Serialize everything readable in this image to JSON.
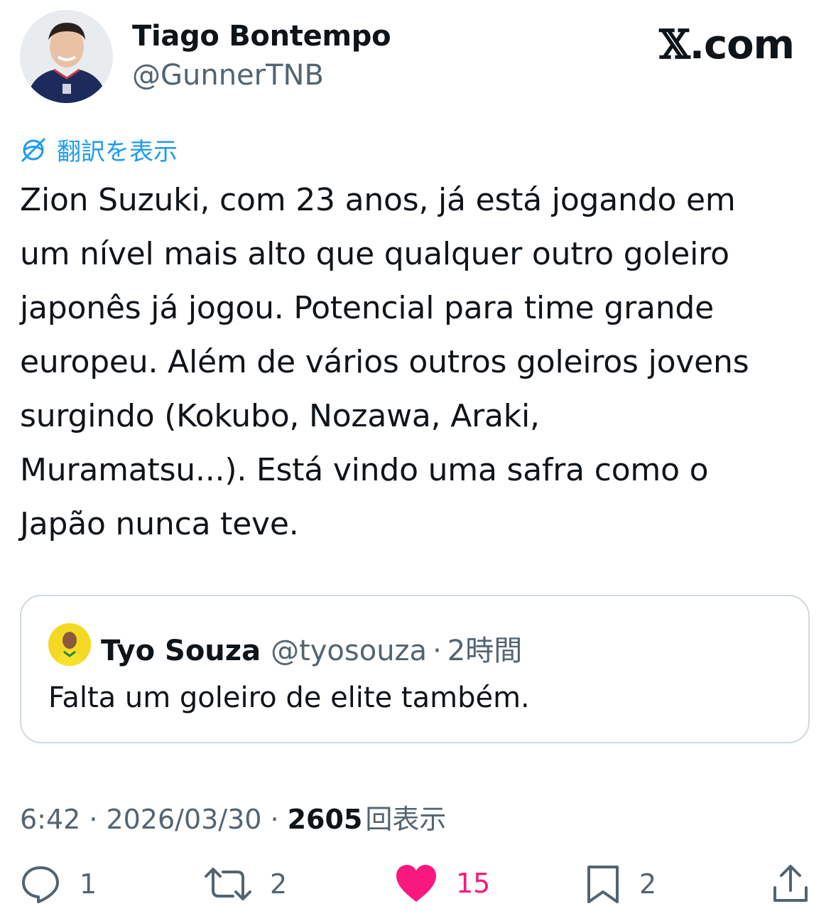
{
  "author": {
    "display_name": "Tiago Bontempo",
    "handle": "@GunnerTNB",
    "avatar_icon": "user-avatar-photo"
  },
  "brand": {
    "logo_letter": "𝕏",
    "logo_suffix": ".com"
  },
  "translate": {
    "icon": "translate-globe-icon",
    "label": "翻訳を表示"
  },
  "tweet": {
    "text": "Zion Suzuki, com 23 anos, já está jogando em\num nível mais alto que qualquer outro goleiro\njaponês já jogou. Potencial para time grande\neuropeu. Além de vários outros goleiros jovens\nsurgindo (Kokubo, Nozawa, Araki,\nMuramatsu...). Está vindo uma safra como o\nJapão nunca teve."
  },
  "quote": {
    "display_name": "Tyo Souza",
    "handle": "@tyosouza",
    "separator": "·",
    "time": "2時間",
    "text": "Falta um goleiro de elite também."
  },
  "meta": {
    "time": "6:42",
    "separator": "·",
    "date": "2026/03/30",
    "views": "2605",
    "views_label": "回表示"
  },
  "actions": {
    "reply_count": "1",
    "retweet_count": "2",
    "like_count": "15",
    "bookmark_count": "2"
  },
  "colors": {
    "link_blue": "#1d9bf0",
    "like_pink": "#f91880",
    "secondary_text": "#536471",
    "border": "#cfd9de"
  }
}
